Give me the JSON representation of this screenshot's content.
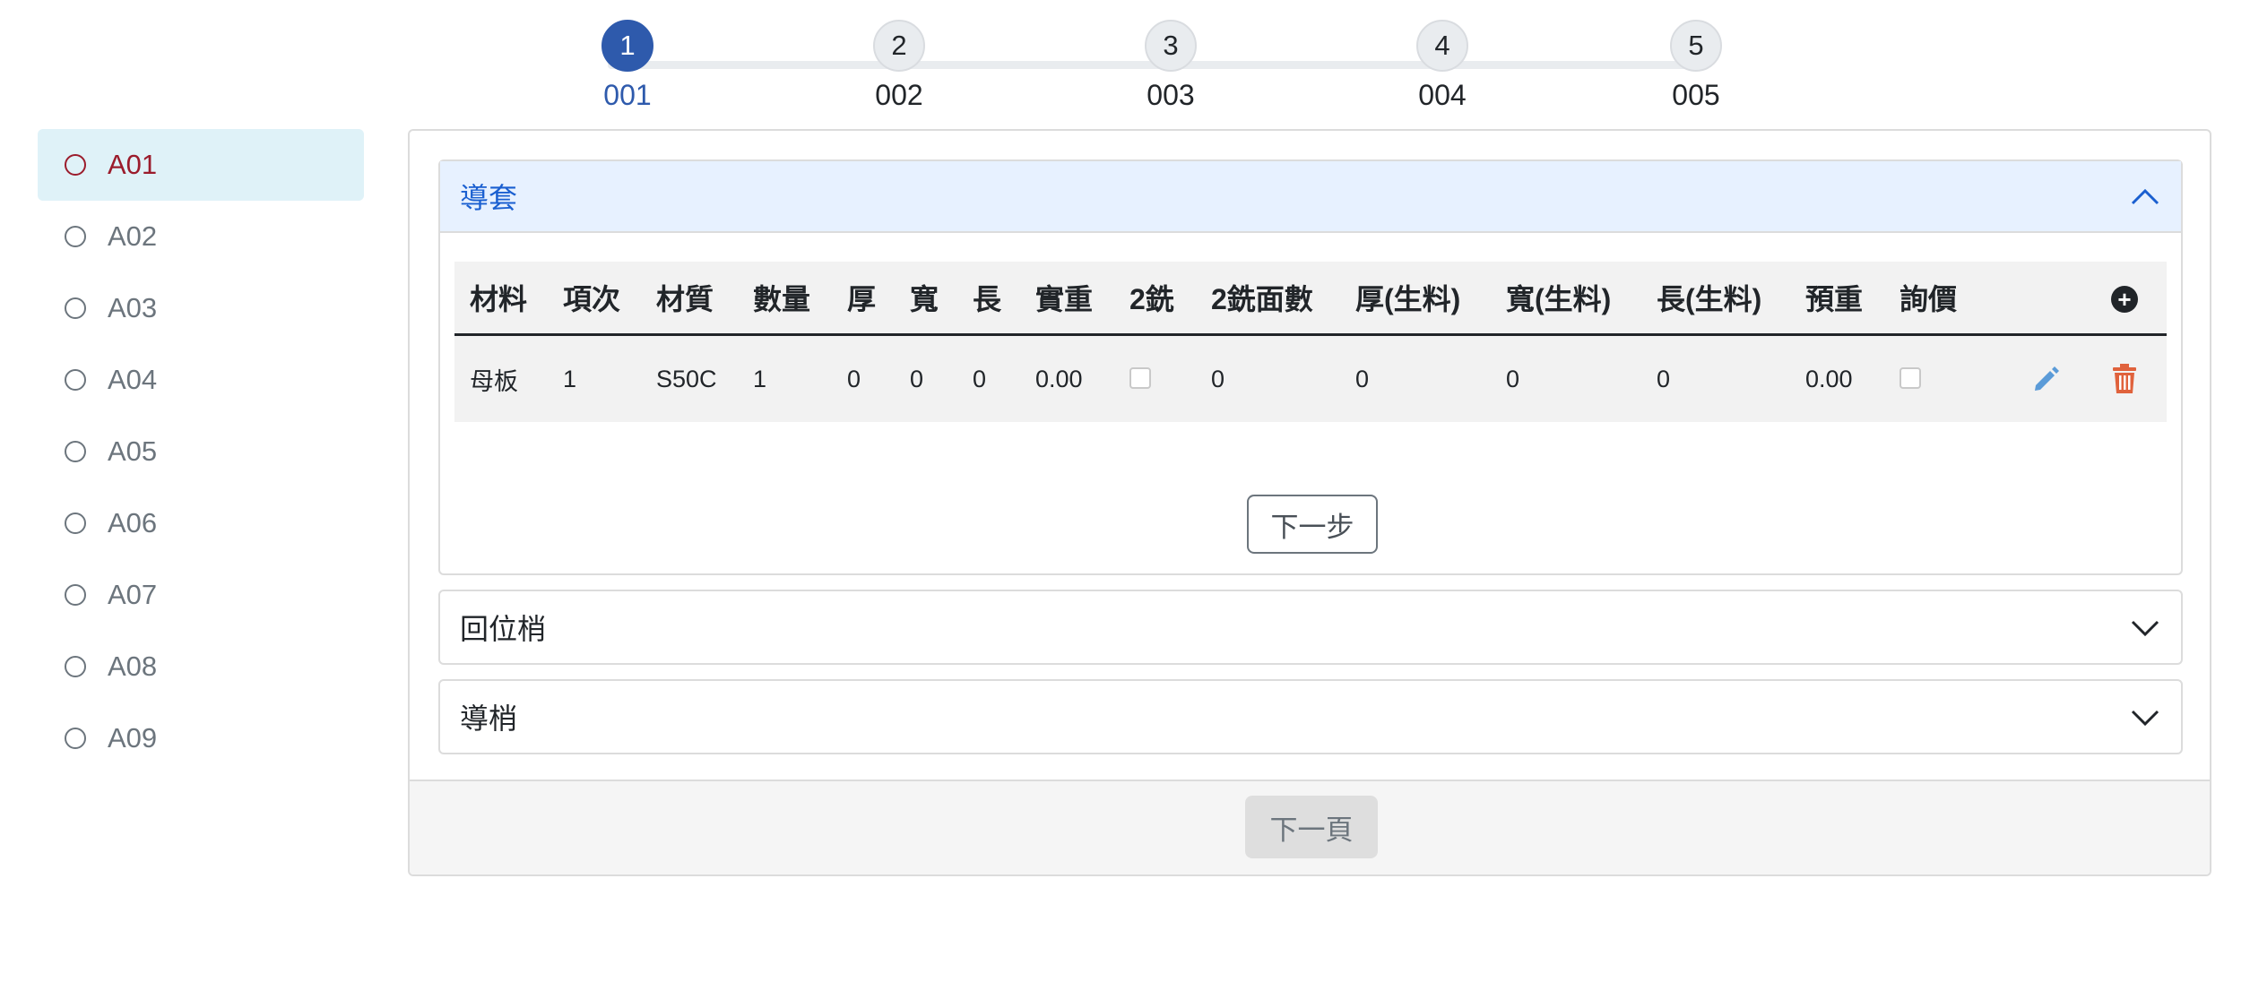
{
  "stepper": {
    "steps": [
      {
        "number": "1",
        "label": "001"
      },
      {
        "number": "2",
        "label": "002"
      },
      {
        "number": "3",
        "label": "003"
      },
      {
        "number": "4",
        "label": "004"
      },
      {
        "number": "5",
        "label": "005"
      }
    ],
    "active_step": 1
  },
  "sidebar": {
    "items": [
      {
        "label": "A01"
      },
      {
        "label": "A02"
      },
      {
        "label": "A03"
      },
      {
        "label": "A04"
      },
      {
        "label": "A05"
      },
      {
        "label": "A06"
      },
      {
        "label": "A07"
      },
      {
        "label": "A08"
      },
      {
        "label": "A09"
      }
    ],
    "active_item": "A01"
  },
  "accordion": {
    "panel1": {
      "title": "導套",
      "state": "expanded",
      "table": {
        "columns": [
          "材料",
          "項次",
          "材質",
          "數量",
          "厚",
          "寬",
          "長",
          "實重",
          "2銑",
          "2銑面數",
          "厚(生料)",
          "寬(生料)",
          "長(生料)",
          "預重",
          "詢價"
        ],
        "rows": [
          {
            "material": "母板",
            "item_no": "1",
            "grade": "S50C",
            "qty": "1",
            "thickness": "0",
            "width": "0",
            "length": "0",
            "actual_weight": "0.00",
            "mill2_checked": false,
            "mill2_faces": "0",
            "raw_thickness": "0",
            "raw_width": "0",
            "raw_length": "0",
            "est_weight": "0.00",
            "inquiry_checked": false
          }
        ]
      },
      "next_step_label": "下一步"
    },
    "panel2": {
      "title": "回位梢",
      "state": "collapsed"
    },
    "panel3": {
      "title": "導梢",
      "state": "collapsed"
    }
  },
  "footer": {
    "next_page_label": "下一頁"
  },
  "icons": {
    "add": "plus-circle-icon",
    "edit": "pencil-icon",
    "delete": "trash-icon",
    "collapse": "chevron-up-icon",
    "expand": "chevron-down-icon"
  },
  "colors": {
    "step_active": "#2e5aac",
    "sidebar_active_bg": "#dff2f8",
    "sidebar_active_text": "#9b1c2c",
    "accordion_active_bg": "#e7f1ff",
    "accordion_active_text": "#1a5fd0",
    "edit_icon": "#5b9bd8",
    "delete_icon": "#e0623c"
  }
}
